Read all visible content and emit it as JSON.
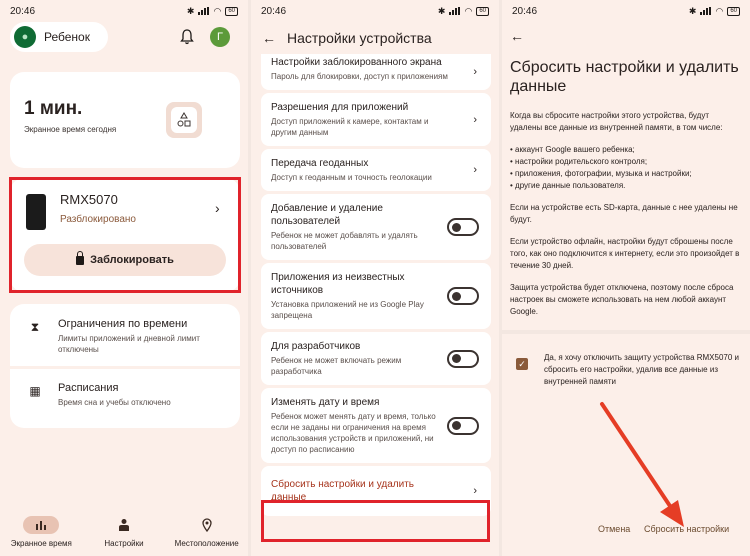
{
  "status": {
    "time": "20:46",
    "battery": "60"
  },
  "screen1": {
    "child_name": "Ребенок",
    "avatar_letter": "Г",
    "time_value": "1 мин.",
    "time_caption": "Экранное время сегодня",
    "device_name": "RMX5070",
    "device_status": "Разблокировано",
    "lock_button": "Заблокировать",
    "limits_title": "Ограничения по времени",
    "limits_sub": "Лимиты приложений и дневной лимит отключены",
    "schedules_title": "Расписания",
    "schedules_sub": "Время сна и учебы отключено",
    "nav": [
      {
        "label": "Экранное время",
        "icon": "bar-chart-icon"
      },
      {
        "label": "Настройки",
        "icon": "person-settings-icon"
      },
      {
        "label": "Местоположение",
        "icon": "location-pin-icon"
      }
    ]
  },
  "screen2": {
    "title": "Настройки устройства",
    "items": [
      {
        "title": "Настройки заблокированного экрана",
        "desc": "Пароль для блокировки, доступ к приложениям",
        "control": "chevron"
      },
      {
        "title": "Разрешения для приложений",
        "desc": "Доступ приложений к камере, контактам и другим данным",
        "control": "chevron"
      },
      {
        "title": "Передача геоданных",
        "desc": "Доступ к геоданным и точность геолокации",
        "control": "chevron"
      },
      {
        "title": "Добавление и удаление пользователей",
        "desc": "Ребенок не может добавлять и удалять пользователей",
        "control": "toggle"
      },
      {
        "title": "Приложения из неизвестных источников",
        "desc": "Установка приложений не из Google Play запрещена",
        "control": "toggle"
      },
      {
        "title": "Для разработчиков",
        "desc": "Ребенок не может включать режим разработчика",
        "control": "toggle"
      },
      {
        "title": "Изменять дату и время",
        "desc": "Ребенок может менять дату и время, только если не заданы ни ограничения на время использования устройств и приложений, ни доступ по расписанию",
        "control": "toggle"
      }
    ],
    "reset_item": "Сбросить настройки и удалить данные"
  },
  "screen3": {
    "title": "Сбросить настройки и удалить данные",
    "intro": "Когда вы сбросите настройки этого устройства, будут удалены все данные из внутренней памяти, в том числе:",
    "bullets": [
      "• аккаунт Google вашего ребенка;",
      "• настройки родительского контроля;",
      "• приложения, фотографии, музыка и настройки;",
      "• другие данные пользователя."
    ],
    "sd_note": "Если на устройстве есть SD-карта, данные с нее удалены не будут.",
    "offline_note": "Если устройство офлайн, настройки будут сброшены после того, как оно подключится к интернету, если это произойдет в течение 30 дней.",
    "protection_note": "Защита устройства будет отключена, поэтому после сброса настроек вы сможете использовать на нем любой аккаунт Google.",
    "consent": "Да, я хочу отключить защиту устройства RMX5070 и сбросить его настройки, удалив все данные из внутренней памяти",
    "cancel": "Отмена",
    "confirm": "Сбросить настройки"
  },
  "colors": {
    "highlight": "#e0232b",
    "accent": "#a6341c",
    "background": "#fcefe9"
  }
}
